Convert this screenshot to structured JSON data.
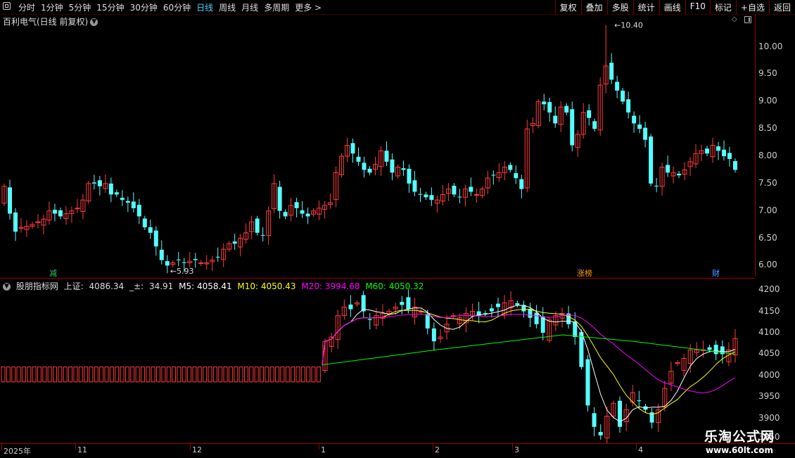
{
  "toolbar": {
    "periods": [
      "分时",
      "1分钟",
      "5分钟",
      "15分钟",
      "30分钟",
      "60分钟",
      "日线",
      "周线",
      "月线",
      "多周期",
      "更多 >"
    ],
    "active_period": "日线",
    "right_buttons": [
      "复权",
      "叠加",
      "多股",
      "统计",
      "画线",
      "F10",
      "标记",
      "+自选",
      "返回"
    ]
  },
  "main": {
    "title": "百利电气(日线 前复权)",
    "y_labels": [
      "10.00",
      "9.50",
      "9.00",
      "8.50",
      "8.00",
      "7.50",
      "7.00",
      "6.50",
      "6.00"
    ],
    "max_label": "10.40",
    "min_label": "5.93",
    "tags": [
      "减",
      "涨榜",
      "财"
    ]
  },
  "sub": {
    "title": "股朋指标网",
    "idx_label": "上证:",
    "idx_value": "4086.34",
    "chg_label": "_±:",
    "chg_value": "34.91",
    "m5": "M5: 4058.41",
    "m10": "M10: 4050.43",
    "m20": "M20: 3994.68",
    "m60": "M60: 4050.32",
    "y_labels": [
      "4200",
      "4150",
      "4100",
      "4050",
      "4000",
      "3950",
      "3900",
      "3850"
    ]
  },
  "x_axis": {
    "labels": [
      "2025年",
      "11",
      "12",
      "1",
      "2",
      "3",
      "4"
    ]
  },
  "watermark": {
    "line1": "乐淘公式网",
    "line2": "www.60lt.com"
  },
  "colors": {
    "up": "#ff3b3b",
    "down": "#54ffff",
    "m5": "#ffffff",
    "m10": "#ffff00",
    "m20": "#ff00ff",
    "m60": "#00ff00",
    "axis": "#a00000"
  },
  "chart_data": [
    {
      "type": "candlestick",
      "name": "百利电气",
      "ylim": [
        5.8,
        10.6
      ],
      "close": [
        7.45,
        6.95,
        6.62,
        6.7,
        6.72,
        6.75,
        6.8,
        6.85,
        7.0,
        6.95,
        6.9,
        6.95,
        7.0,
        7.05,
        7.2,
        7.5,
        7.5,
        7.45,
        7.5,
        7.3,
        7.3,
        7.2,
        7.15,
        7.05,
        6.9,
        6.7,
        6.6,
        6.35,
        6.1,
        6.0,
        6.05,
        6.1,
        6.05,
        6.08,
        6.1,
        6.05,
        6.05,
        6.1,
        6.15,
        6.3,
        6.4,
        6.4,
        6.5,
        6.6,
        6.8,
        6.6,
        6.55,
        7.0,
        7.5,
        7.0,
        6.9,
        7.1,
        7.05,
        6.95,
        6.9,
        7.0,
        7.05,
        7.1,
        7.15,
        7.7,
        8.0,
        8.2,
        8.05,
        7.9,
        7.75,
        7.7,
        7.85,
        8.1,
        7.9,
        7.7,
        7.8,
        7.75,
        7.5,
        7.35,
        7.3,
        7.25,
        7.2,
        7.2,
        7.3,
        7.4,
        7.3,
        7.25,
        7.4,
        7.35,
        7.3,
        7.4,
        7.6,
        7.65,
        7.7,
        7.8,
        7.75,
        7.6,
        7.4,
        8.5,
        8.6,
        9.0,
        8.95,
        8.8,
        8.6,
        8.9,
        8.8,
        8.2,
        8.4,
        8.8,
        8.7,
        8.5,
        9.3,
        9.65,
        9.4,
        9.2,
        9.0,
        8.8,
        8.6,
        8.5,
        8.3,
        7.5,
        7.45,
        7.8,
        7.7,
        7.7,
        7.65,
        7.75,
        7.9,
        8.05,
        8.1,
        8.05,
        8.2,
        8.1,
        8.0,
        7.95,
        7.75
      ],
      "high": 8.35,
      "max": 10.4,
      "min": 5.93
    },
    {
      "type": "candlestick",
      "name": "上证",
      "ylim": [
        3850,
        4220
      ],
      "m5": 4058.41,
      "m10": 4050.43,
      "m20": 3994.68,
      "m60": 4050.32,
      "close": [
        4080,
        4090,
        4140,
        4160,
        4155,
        4170,
        4150,
        4130,
        4140,
        4145,
        4150,
        4160,
        4165,
        4155,
        4160,
        4150,
        4110,
        4080,
        4090,
        4120,
        4140,
        4135,
        4145,
        4150,
        4140,
        4145,
        4150,
        4160,
        4170,
        4175,
        4165,
        4150,
        4135,
        4120,
        4100,
        4130,
        4140,
        4145,
        4120,
        4090,
        4020,
        3930,
        3880,
        3860,
        3905,
        3935,
        3880,
        3920,
        3960,
        3940,
        3920,
        3890,
        3920,
        3970,
        4010,
        4030,
        4040,
        4060,
        4060,
        4060,
        4060,
        4050,
        4050,
        4060,
        4086.34
      ]
    }
  ]
}
